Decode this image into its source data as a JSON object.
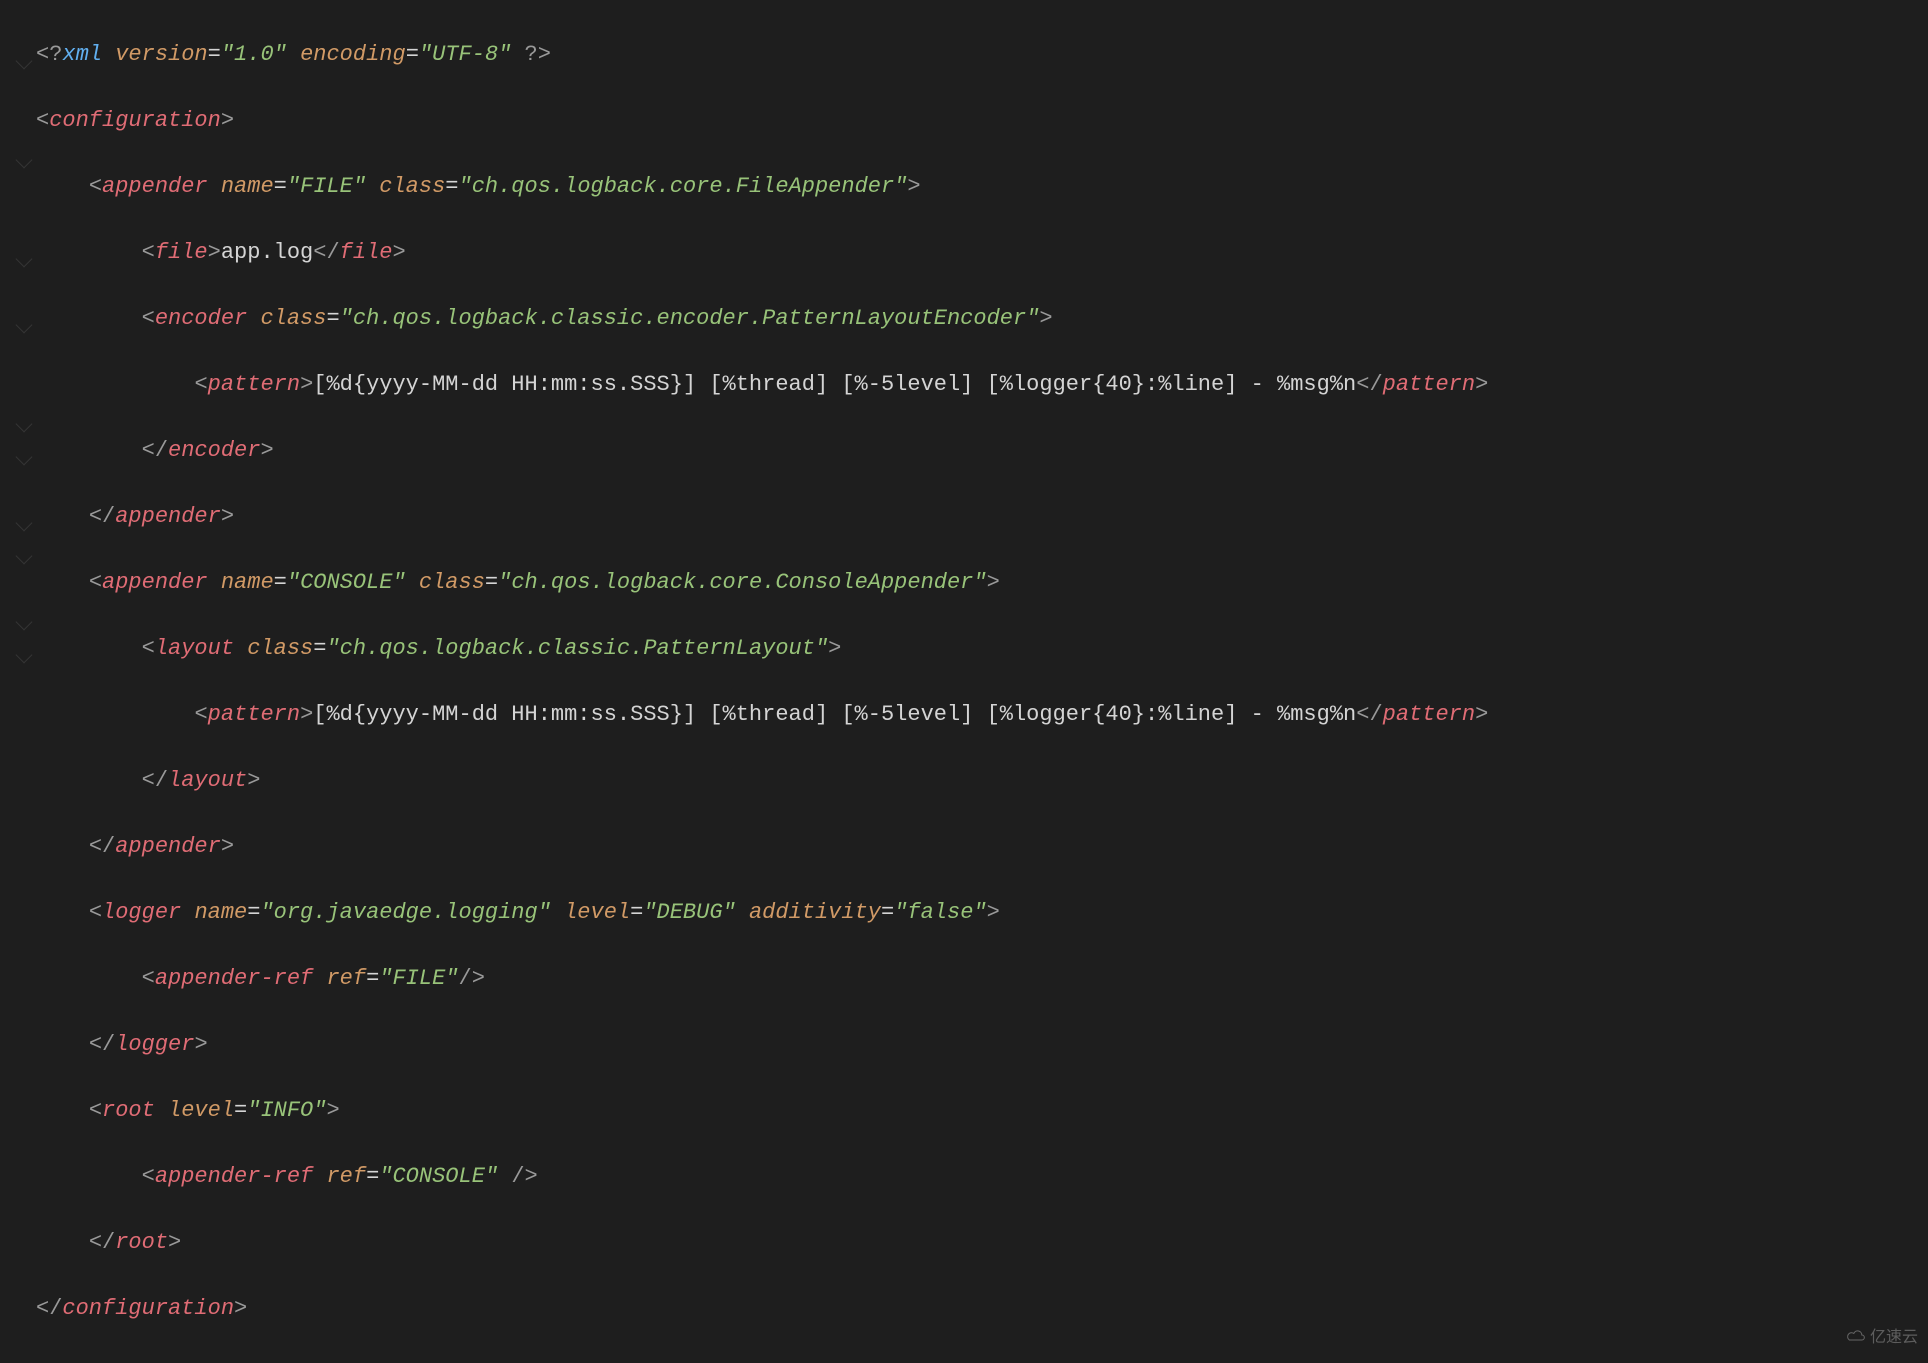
{
  "xml_decl": {
    "version": "1.0",
    "encoding": "UTF-8"
  },
  "root_tag": "configuration",
  "appenders": [
    {
      "tag": "appender",
      "name": "FILE",
      "class": "ch.qos.logback.core.FileAppender",
      "file_tag": "file",
      "file_value": "app.log",
      "wrapper_tag": "encoder",
      "wrapper_class": "ch.qos.logback.classic.encoder.PatternLayoutEncoder",
      "pattern_tag": "pattern",
      "pattern_value": "[%d{yyyy-MM-dd HH:mm:ss.SSS}] [%thread] [%-5level] [%logger{40}:%line] - %msg%n"
    },
    {
      "tag": "appender",
      "name": "CONSOLE",
      "class": "ch.qos.logback.core.ConsoleAppender",
      "wrapper_tag": "layout",
      "wrapper_class": "ch.qos.logback.classic.PatternLayout",
      "pattern_tag": "pattern",
      "pattern_value": "[%d{yyyy-MM-dd HH:mm:ss.SSS}] [%thread] [%-5level] [%logger{40}:%line] - %msg%n"
    }
  ],
  "logger": {
    "tag": "logger",
    "name": "org.javaedge.logging",
    "level": "DEBUG",
    "additivity": "false",
    "ref_tag": "appender-ref",
    "ref_value": "FILE"
  },
  "root": {
    "tag": "root",
    "level": "INFO",
    "ref_tag": "appender-ref",
    "ref_value": "CONSOLE"
  },
  "watermark": "亿速云"
}
